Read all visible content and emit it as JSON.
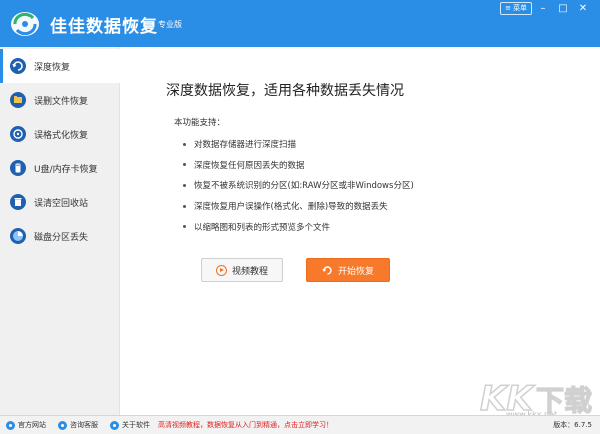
{
  "app": {
    "title": "佳佳数据恢复",
    "edition": "专业版",
    "menu_label": "菜单",
    "logo_icon": "recovery-cycle-logo"
  },
  "sidebar": {
    "items": [
      {
        "label": "深度恢复",
        "icon": "deep-recovery-icon",
        "active": true
      },
      {
        "label": "误删文件恢复",
        "icon": "folder-icon",
        "active": false
      },
      {
        "label": "误格式化恢复",
        "icon": "disk-icon",
        "active": false
      },
      {
        "label": "U盘/内存卡恢复",
        "icon": "usb-icon",
        "active": false
      },
      {
        "label": "误清空回收站",
        "icon": "recycle-bin-icon",
        "active": false
      },
      {
        "label": "磁盘分区丢失",
        "icon": "partition-icon",
        "active": false
      }
    ]
  },
  "main": {
    "title": "深度数据恢复，适用各种数据丢失情况",
    "func_label": "本功能支持：",
    "features": [
      "对数据存储器进行深度扫描",
      "深度恢复任何原因丢失的数据",
      "恢复不被系统识别的分区(如:RAW分区或非Windows分区)",
      "深度恢复用户误操作(格式化、删除)导致的数据丢失",
      "以缩略图和列表的形式预览多个文件"
    ],
    "video_button": "视频教程",
    "start_button": "开始恢复"
  },
  "statusbar": {
    "website": "官方网站",
    "support": "咨询客服",
    "about": "关于软件",
    "promo": "高清视频教程，数据恢复从入门到精通，点击立即学习！",
    "version": "版本：6.7.5"
  },
  "watermark": {
    "logo_text": "KK下载",
    "url": "www.kkx.net"
  },
  "colors": {
    "titlebar": "#2a8ee6",
    "accent": "#2a8ee6",
    "start_button": "#f77a2c",
    "promo": "#e02020"
  }
}
